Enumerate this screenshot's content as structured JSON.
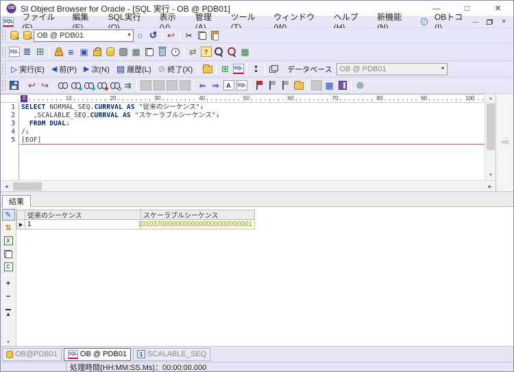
{
  "titlebar": {
    "title": "SI Object Browser for Oracle - [SQL 実行 - OB @ PDB01]"
  },
  "menubar": {
    "items": [
      "ファイル(F)",
      "編集(E)",
      "SQL実行(O)",
      "表示(V)",
      "管理(A)",
      "ツール(T)",
      "ウィンドウ(W)",
      "ヘルプ(H)",
      "新機能(N)",
      "OBトコ(I)"
    ]
  },
  "session_toolbar": {
    "connection": "OB @ PDB01"
  },
  "exec_toolbar": {
    "run": "実行(E)",
    "prev": "前(P)",
    "next": "次(N)",
    "history": "履歴(L)",
    "end": "終了(X)",
    "database_label": "データベース",
    "database_value": "OB @ PDB01"
  },
  "ruler": {
    "ticks": [
      "0",
      "10",
      "20",
      "30",
      "40",
      "50",
      "60",
      "70",
      "80",
      "90",
      "100"
    ]
  },
  "editor": {
    "lines": [
      {
        "no": "1",
        "segments": [
          {
            "t": "SELECT ",
            "c": "kw"
          },
          {
            "t": "NORMAL_SEQ.",
            "c": "pl"
          },
          {
            "t": "CURRVAL ",
            "c": "kw"
          },
          {
            "t": "AS ",
            "c": "kw"
          },
          {
            "t": "\"従来のシーケンス\"",
            "c": "pl"
          },
          {
            "t": "↓",
            "c": "mk"
          }
        ]
      },
      {
        "no": "2",
        "segments": [
          {
            "t": "   ,SCALABLE_SEQ.",
            "c": "pl"
          },
          {
            "t": "CURRVAL ",
            "c": "kw"
          },
          {
            "t": "AS ",
            "c": "kw"
          },
          {
            "t": "\"スケーラブルシーケンス\"",
            "c": "pl"
          },
          {
            "t": "↓",
            "c": "mk"
          }
        ]
      },
      {
        "no": "3",
        "segments": [
          {
            "t": "  ",
            "c": "pl"
          },
          {
            "t": "FROM DUAL",
            "c": "kw"
          },
          {
            "t": "↓",
            "c": "mk"
          }
        ]
      },
      {
        "no": "4",
        "segments": [
          {
            "t": "/",
            "c": "pl"
          },
          {
            "t": "↓",
            "c": "mk"
          }
        ]
      },
      {
        "no": "5",
        "segments": [
          {
            "t": "[EOF]",
            "c": "eof"
          }
        ]
      }
    ]
  },
  "results": {
    "tab": "結果",
    "columns": [
      "従来のシーケンス",
      "スケーラブルシーケンス"
    ],
    "rows": [
      {
        "marker": "▶",
        "cells": [
          "1",
          "101037000000000000000000000001"
        ]
      }
    ]
  },
  "taskbar": {
    "buttons": [
      {
        "label": "OB@PDB01"
      },
      {
        "label": "OB @ PDB01"
      },
      {
        "label": "SCALABLE_SEQ"
      }
    ]
  },
  "statusbar": {
    "time_text": "処理時間(HH:MM:SS.Ms)：00:00:00.000"
  },
  "icons": {
    "app_badge": "OB",
    "menu_window": "SQL",
    "info": "i",
    "win_min": "—",
    "win_max": "□",
    "win_close": "✕",
    "mdi_min": "—",
    "mdi_close": "✕",
    "commit": "○",
    "rollback": "↺",
    "undo_sql": "↩",
    "cut": "✂",
    "sql_text": "SQL",
    "script": "≣",
    "window_grid": "⊞",
    "storage": "≡",
    "monitor": "▣",
    "chip": "▦",
    "switch": "⇄",
    "help": "?",
    "table_sync": "▦",
    "run": "▷",
    "prev": "◀",
    "next": "▶",
    "history": "▤",
    "terminate": "⊘",
    "tri_up": "▲",
    "tri_down": "▼",
    "undo": "↩",
    "redo": "↪",
    "goto_line": "⇉",
    "outdent": "⇐",
    "indent": "⇒",
    "letter_a": "A",
    "grid_blue": "▦",
    "gear": "⊛",
    "pencil": "✎",
    "sort": "⇅",
    "excel": "X",
    "csv": "C",
    "add": "+",
    "remove": "−",
    "jump_end": "▲",
    "more": "▼",
    "collapse": "<<",
    "sc_up": "▲",
    "sc_down": "▼",
    "sc_left": "◀",
    "sc_right": "▶",
    "plus_badge": "+",
    "minus_badge": "−",
    "seq_badge": "1"
  }
}
